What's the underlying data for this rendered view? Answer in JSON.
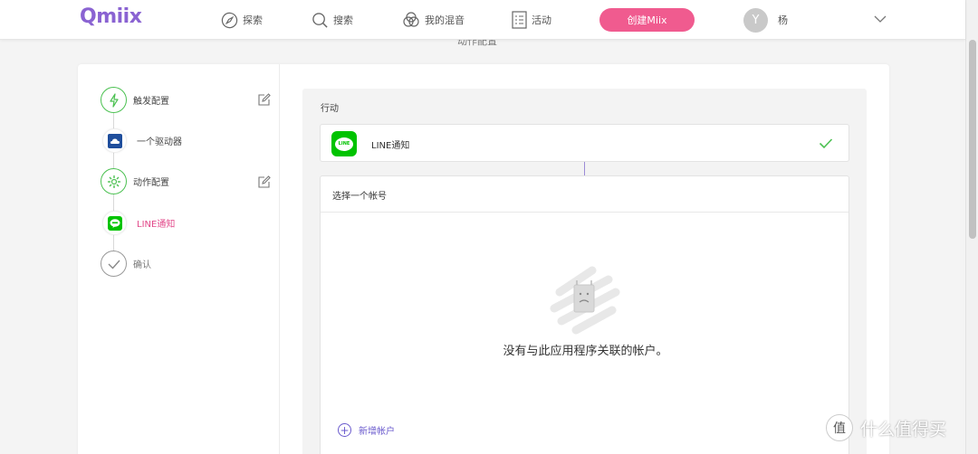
{
  "brand": {
    "logo": "Qmiix",
    "accent": "#8a63d2",
    "primary_button_color": "#f05b8f",
    "success_color": "#4cc152"
  },
  "nav": {
    "items": [
      {
        "label": "探索",
        "icon": "compass-icon"
      },
      {
        "label": "搜索",
        "icon": "search-icon"
      },
      {
        "label": "我的混音",
        "icon": "mix-icon"
      },
      {
        "label": "活动",
        "icon": "activity-list-icon"
      }
    ],
    "create_label": "创建Miix",
    "avatar_letter": "Y",
    "username": "杨"
  },
  "page_title_behind": "动作配置",
  "steps": [
    {
      "label": "触发配置",
      "icon": "bolt-icon",
      "state": "done",
      "editable": true
    },
    {
      "label": "一个驱动器",
      "icon": "onedrive-icon",
      "state": "service",
      "editable": false
    },
    {
      "label": "动作配置",
      "icon": "gear-icon",
      "state": "done",
      "editable": true
    },
    {
      "label": "LINE通知",
      "icon": "line-icon",
      "state": "active",
      "editable": false
    },
    {
      "label": "确认",
      "icon": "check-icon",
      "state": "pending",
      "editable": false
    }
  ],
  "panel": {
    "title": "行动",
    "action": {
      "label": "LINE通知",
      "logo_text": "LINE"
    },
    "account_section": {
      "header": "选择一个帐号",
      "empty_message": "没有与此应用程序关联的帐户。",
      "add_label": "新增帐户"
    }
  },
  "watermark": {
    "text": "什么值得买",
    "logo": "值"
  }
}
